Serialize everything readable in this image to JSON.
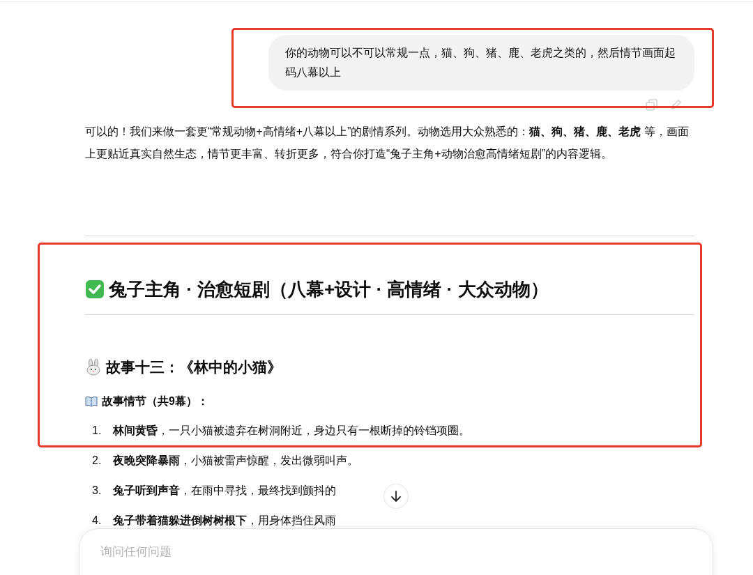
{
  "user_message": {
    "text": "你的动物可以不可以常规一点，猫、狗、猪、鹿、老虎之类的，然后情节画面起码八幕以上"
  },
  "response": {
    "intro": "可以的！我们来做一套更“常规动物+高情绪+八幕以上”的剧情系列。动物选用大众熟悉的：**猫、狗、猪、鹿、老虎** 等，画面上更贴近真实自然生态，情节更丰富、转折更多，符合你打造“兔子主角+动物治愈高情绪短剧”的内容逻辑。",
    "title": "兔子主角 · 治愈短剧（八幕+设计 · 高情绪 · 大众动物）",
    "story_title": "故事十三：《林中的小猫》",
    "section_label": "故事情节（共9幕）：",
    "acts": [
      {
        "number": "1.",
        "text": "**林间黄昏**，一只小猫被遗弃在树洞附近，身边只有一根断掉的铃铛项圈。"
      },
      {
        "number": "2.",
        "text": "**夜晚突降暴雨**，小猫被雷声惊醒，发出微弱叫声。"
      },
      {
        "number": "3.",
        "text": "**兔子听到声音**，在雨中寻找，最终找到颤抖的"
      },
      {
        "number": "4.",
        "text": "**兔子带着猫躲进倒树树根下**，用身体挡住风雨"
      }
    ]
  },
  "composer": {
    "placeholder": "询问任何问题"
  }
}
